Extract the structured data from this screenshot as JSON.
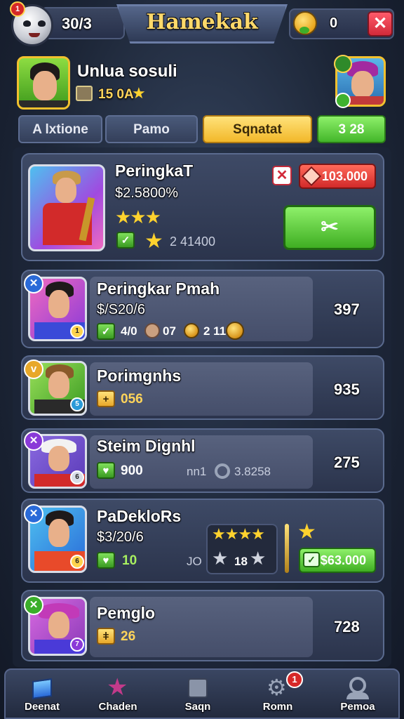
{
  "header": {
    "rank_badge": "1",
    "level": "30/3",
    "title": "Hamekak",
    "coins": "0",
    "close_label": "✕"
  },
  "profile": {
    "name": "Unlua sosuli",
    "stat": "15 0A",
    "star": "★"
  },
  "tabs": [
    {
      "label": "A lxtione",
      "active": false
    },
    {
      "label": "Pamo",
      "active": false
    },
    {
      "label": "Sqnatat",
      "active": true
    },
    {
      "label": "3 28",
      "active": false
    }
  ],
  "cards": [
    {
      "name": "PeringkaT",
      "sub": "$2.5800%",
      "stars": "★★★",
      "extra_value": "2 41400",
      "price": "103.000",
      "action_icon": "✂"
    },
    {
      "name": "Peringkar Pmah",
      "sub": "$/S20/6",
      "stat1": "4/0",
      "stat2": "07",
      "stat3": "2 11",
      "score": "397",
      "badge": "✕",
      "mini": "1"
    },
    {
      "name": "Porimgnhs",
      "stat1": "056",
      "score": "935",
      "badge": "v",
      "mini": "5"
    },
    {
      "name": "Steim Dignhl",
      "stat1": "900",
      "muted1": "nn1",
      "muted2": "3.8258",
      "score": "275",
      "badge": "✕",
      "mini": "6"
    },
    {
      "name": "PaDekloRs",
      "sub": "$3/20/6",
      "stat1": "10",
      "muted1": "JO",
      "stars": "★★★★",
      "star_count": "18",
      "price": "$63.000",
      "badge": "✕",
      "mini": "6"
    },
    {
      "name": "Pemglo",
      "stat1": "26",
      "score": "728",
      "badge": "✕",
      "mini": "7"
    }
  ],
  "nav": [
    {
      "label": "Deenat",
      "icon": "cube-icon"
    },
    {
      "label": "Chaden",
      "icon": "star-shield-icon"
    },
    {
      "label": "Saqn",
      "icon": "grid-icon"
    },
    {
      "label": "Romn",
      "icon": "gear-icon",
      "badge": "1"
    },
    {
      "label": "Pemoa",
      "icon": "person-icon"
    }
  ],
  "colors": {
    "accent_gold": "#ffd45a",
    "active_tab": "#f2b82a",
    "confirm_green": "#3fae22",
    "danger_red": "#d22a2a"
  }
}
